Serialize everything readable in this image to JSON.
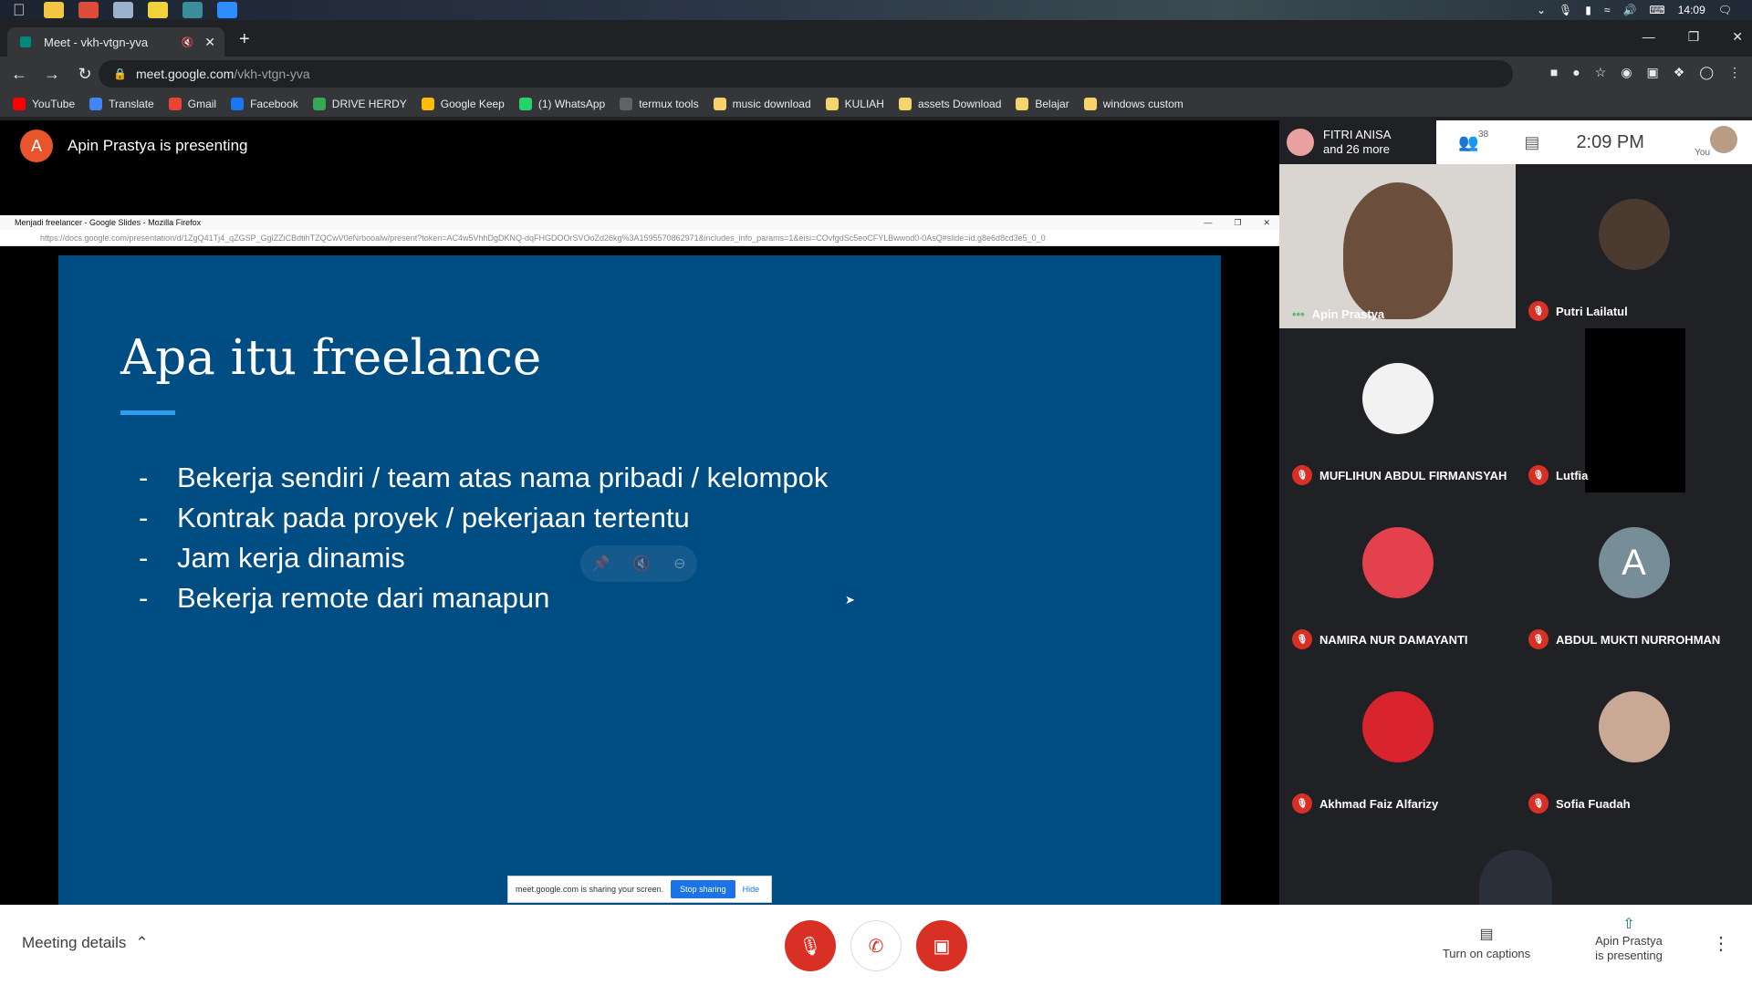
{
  "taskbar": {
    "time": "14:09"
  },
  "browser": {
    "tab_title": "Meet - vkh-vtgn-yva",
    "url_host": "meet.google.com",
    "url_path": "/vkh-vtgn-yva",
    "bookmarks": [
      {
        "label": "YouTube",
        "color": "#ff0000"
      },
      {
        "label": "Translate",
        "color": "#4285f4"
      },
      {
        "label": "Gmail",
        "color": "#ea4335"
      },
      {
        "label": "Facebook",
        "color": "#1877f2"
      },
      {
        "label": "DRIVE HERDY",
        "color": "#34a853"
      },
      {
        "label": "Google Keep",
        "color": "#fbbc04"
      },
      {
        "label": "(1) WhatsApp",
        "color": "#25d366"
      },
      {
        "label": "termux tools",
        "color": "#5f6368"
      },
      {
        "label": "music download",
        "color": "#f6d36b"
      },
      {
        "label": "KULIAH",
        "color": "#f6d36b"
      },
      {
        "label": "assets Download",
        "color": "#f6d36b"
      },
      {
        "label": "Belajar",
        "color": "#f6d36b"
      },
      {
        "label": "windows custom",
        "color": "#f6d36b"
      }
    ]
  },
  "meet": {
    "presenting_label": "Apin Prastya is presenting",
    "presenter_initial": "A",
    "participants_count": "38",
    "first_participant": "FITRI ANISA",
    "and_more": "and 26 more",
    "clock": "2:09 PM",
    "you_label": "You"
  },
  "shared_window": {
    "title": "Menjadi freelancer - Google Slides - Mozilla Firefox",
    "url": "https://docs.google.com/presentation/d/1ZgQ41Tj4_qZGSP_GglZZiCBdtihTZQCwV0eNrbooalw/present?token=AC4w5VhhDgDKNQ-dqFHGDOOrSVOoZd26kg%3A1595570862971&includes_info_params=1&eisi=COvfgdSc5eoCFYLBwwod0-0AsQ#slide=id.g8e6d8cd3e5_0_0"
  },
  "slide": {
    "title": "Apa itu freelance",
    "bullets": [
      "Bekerja sendiri / team atas nama pribadi / kelompok",
      "Kontrak pada proyek / pekerjaan tertentu",
      "Jam kerja dinamis",
      "Bekerja remote dari manapun"
    ]
  },
  "share_bar": {
    "text": "meet.google.com is sharing your screen.",
    "stop": "Stop sharing",
    "hide": "Hide"
  },
  "participants": [
    {
      "name": "Apin Prastya"
    },
    {
      "name": "Putri Lailatul"
    },
    {
      "name": "MUFLIHUN ABDUL FIRMANSYAH"
    },
    {
      "name": "Lutfia"
    },
    {
      "name": "NAMIRA NUR DAMAYANTI"
    },
    {
      "name": "ABDUL MUKTI NURROHMAN",
      "initial": "A"
    },
    {
      "name": "Akhmad Faiz Alfarizy"
    },
    {
      "name": "Sofia Fuadah"
    }
  ],
  "bottom": {
    "meeting_details": "Meeting details",
    "captions": "Turn on captions",
    "presenting_line1": "Apin Prastya",
    "presenting_line2": "is presenting"
  }
}
